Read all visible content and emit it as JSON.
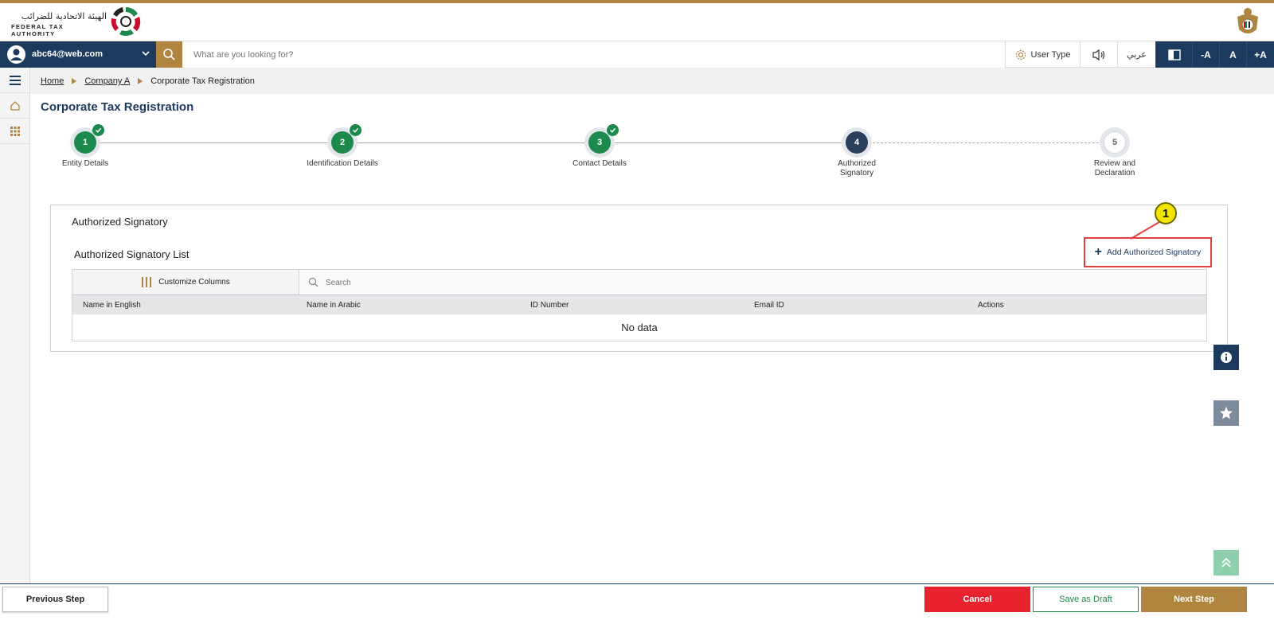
{
  "brand": {
    "arabic_name": "الهيئة الاتحادية للضرائب",
    "english_name": "FEDERAL TAX AUTHORITY",
    "accent_gold": "#b0853f",
    "navy": "#1c3a5e",
    "green": "#1c8a4c"
  },
  "toolbar": {
    "user_email": "abc64@web.com",
    "search_placeholder": "What are you looking for?",
    "user_type_label": "User Type",
    "arabic_label": "عربي",
    "font_decrease": "-A",
    "font_normal": "A",
    "font_increase": "+A"
  },
  "breadcrumb": {
    "items": [
      "Home",
      "Company A",
      "Corporate Tax Registration"
    ]
  },
  "page": {
    "title": "Corporate Tax Registration"
  },
  "stepper": {
    "steps": [
      {
        "number": "1",
        "label": "Entity Details",
        "status": "done"
      },
      {
        "number": "2",
        "label": "Identification Details",
        "status": "done"
      },
      {
        "number": "3",
        "label": "Contact Details",
        "status": "done"
      },
      {
        "number": "4",
        "label": "Authorized Signatory",
        "status": "active"
      },
      {
        "number": "5",
        "label": "Review and Declaration",
        "status": "pending"
      }
    ]
  },
  "panel": {
    "title": "Authorized Signatory",
    "list_title": "Authorized Signatory List",
    "add_button": "Add Authorized Signatory",
    "customize_columns": "Customize Columns",
    "search_placeholder": "Search",
    "columns": [
      "Name in English",
      "Name in Arabic",
      "ID Number",
      "Email ID",
      "Actions"
    ],
    "empty_text": "No data"
  },
  "annotation": {
    "marker": "1"
  },
  "footer": {
    "previous": "Previous Step",
    "cancel": "Cancel",
    "save_draft": "Save as Draft",
    "next": "Next Step"
  }
}
